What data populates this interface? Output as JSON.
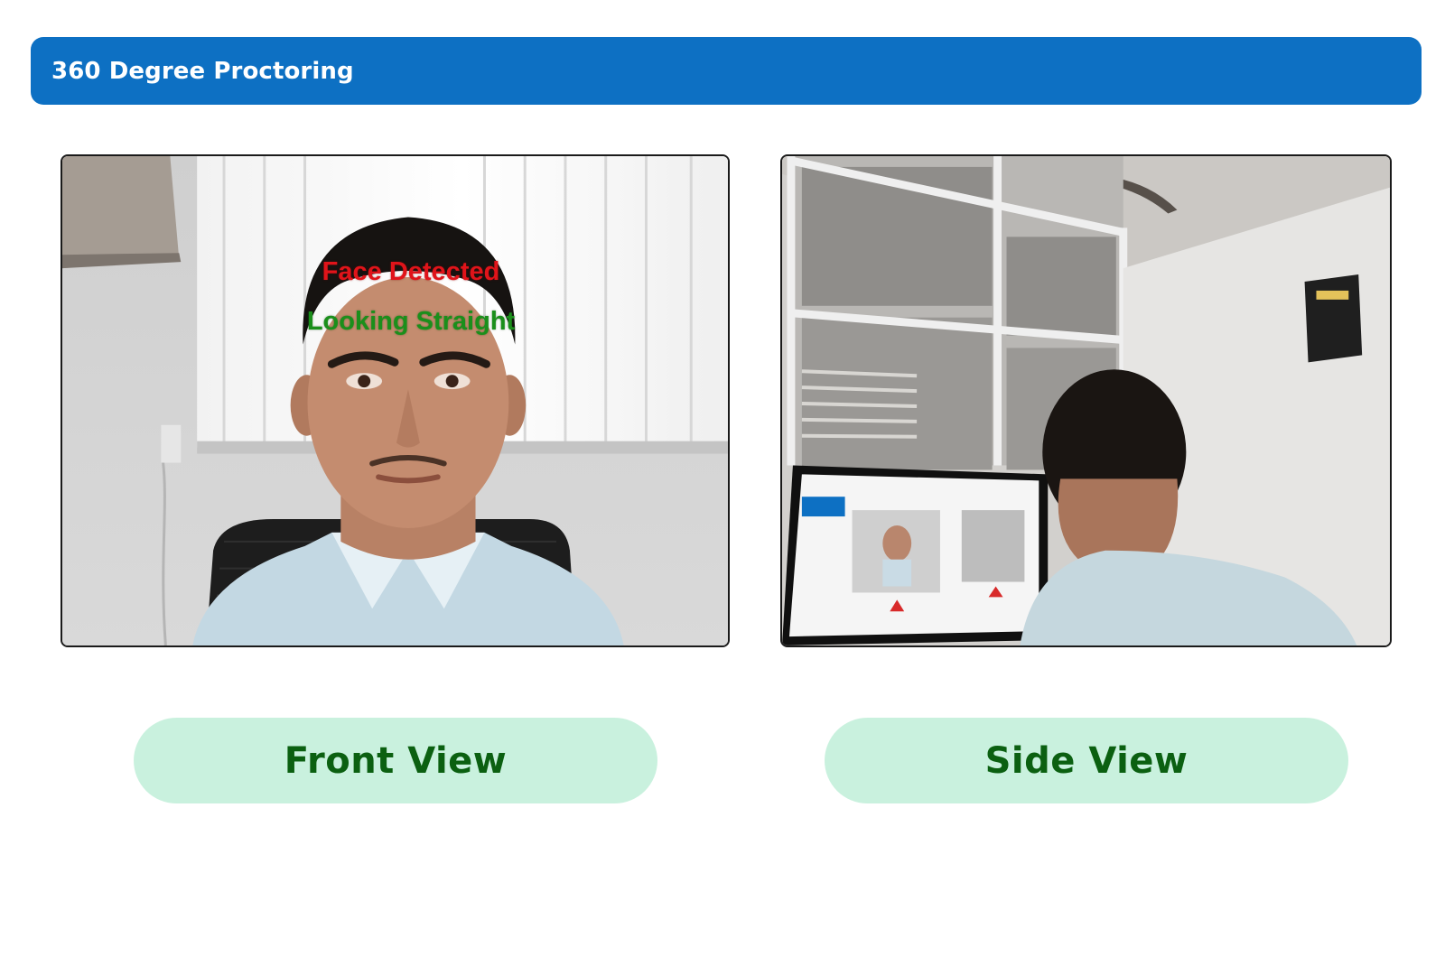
{
  "header": {
    "title": "360 Degree Proctoring",
    "color": "#0d70c3"
  },
  "front_view": {
    "label": "Front View",
    "overlay": {
      "face_status": "Face Detected",
      "gaze_status": "Looking Straight",
      "face_status_color": "#e0141a",
      "gaze_status_color": "#1b8f1b"
    }
  },
  "side_view": {
    "label": "Side View"
  },
  "colors": {
    "pill_background": "#c9f1de",
    "pill_text": "#0b6011"
  }
}
